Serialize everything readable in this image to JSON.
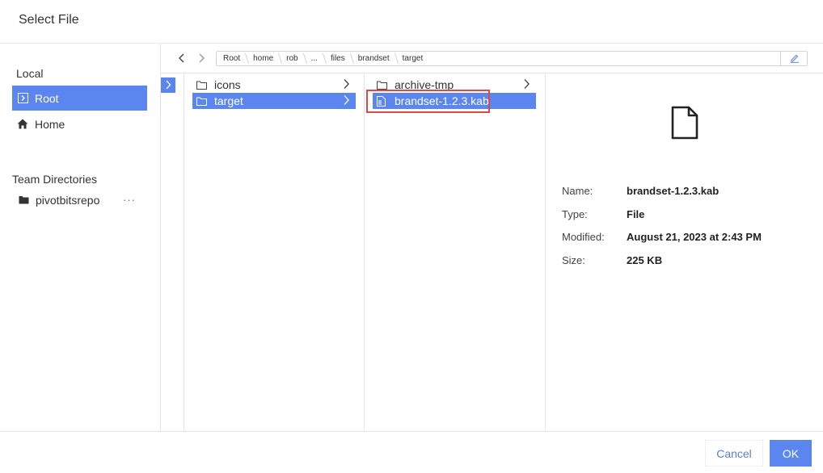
{
  "dialog": {
    "title": "Select File"
  },
  "sidebar": {
    "local_label": "Local",
    "local_items": [
      {
        "label": "Root",
        "icon": "chevron-right-icon",
        "active": true
      },
      {
        "label": "Home",
        "icon": "home-icon",
        "active": false
      }
    ],
    "team_label": "Team Directories",
    "team_items": [
      {
        "label": "pivotbitsrepo",
        "icon": "folder-icon",
        "more": "···"
      }
    ]
  },
  "breadcrumb": [
    "Root",
    "home",
    "rob",
    "...",
    "files",
    "brandset",
    "target"
  ],
  "columns": {
    "col1": [
      {
        "label": "icons",
        "icon": "folder-outline-icon",
        "selected": false
      },
      {
        "label": "target",
        "icon": "folder-outline-icon",
        "selected": true
      }
    ],
    "col2": [
      {
        "label": "archive-tmp",
        "icon": "folder-outline-icon",
        "selected": false
      },
      {
        "label": "brandset-1.2.3.kab",
        "icon": "file-icon",
        "selected": true
      }
    ]
  },
  "details": {
    "icon": "document-icon",
    "rows": [
      {
        "label": "Name:",
        "value": "brandset-1.2.3.kab"
      },
      {
        "label": "Type:",
        "value": "File"
      },
      {
        "label": "Modified:",
        "value": "August 21, 2023 at 2:43 PM"
      },
      {
        "label": "Size:",
        "value": "225 KB"
      }
    ]
  },
  "footer": {
    "cancel_label": "Cancel",
    "ok_label": "OK"
  },
  "colors": {
    "accent": "#5b86f0",
    "highlight_border": "#d94a4a",
    "cancel_text": "#5b7fd6"
  }
}
